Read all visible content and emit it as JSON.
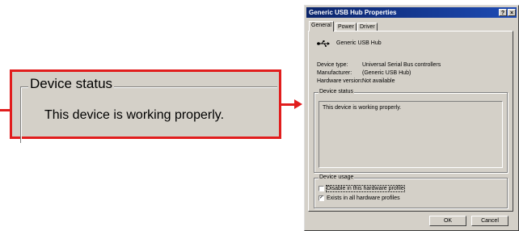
{
  "callout": {
    "legend": "Device status",
    "text": "This device is working properly."
  },
  "dialog": {
    "title": "Generic USB Hub Properties",
    "title_buttons": {
      "help": "?",
      "close": "×"
    },
    "tabs": [
      {
        "label": "General",
        "active": true
      },
      {
        "label": "Power",
        "active": false
      },
      {
        "label": "Driver",
        "active": false
      }
    ],
    "device_name": "Generic USB Hub",
    "device_icon": "usb-icon",
    "properties": [
      {
        "label": "Device type:",
        "value": "Universal Serial Bus controllers"
      },
      {
        "label": "Manufacturer:",
        "value": "(Generic USB Hub)"
      },
      {
        "label": "Hardware version:",
        "value": "Not available"
      }
    ],
    "status_group": {
      "legend": "Device status",
      "text": "This device is working properly."
    },
    "usage_group": {
      "legend": "Device usage",
      "options": [
        {
          "label": "Disable in this hardware profile",
          "checked": false
        },
        {
          "label": "Exists in all hardware profiles",
          "checked": true
        }
      ]
    },
    "buttons": {
      "ok": "OK",
      "cancel": "Cancel"
    }
  },
  "colors": {
    "accent": "#e11d1d",
    "titlebar": "#0a246a",
    "face": "#d4d0c8"
  }
}
